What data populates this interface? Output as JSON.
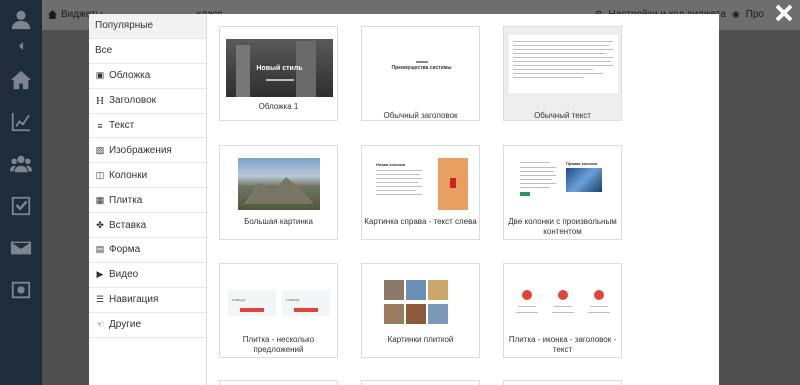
{
  "topbar": {
    "breadcrumb": "Виджеты",
    "breadcrumb_tail": "класс",
    "settings_label": "Настройки и код виджета",
    "preview_label": "Про"
  },
  "categories": [
    {
      "label": "Популярные",
      "icon": "none",
      "active": true
    },
    {
      "label": "Все",
      "icon": "none"
    },
    {
      "label": "Обложка",
      "icon": "camera-icon"
    },
    {
      "label": "Заголовок",
      "icon": "header-icon",
      "glyph": "H"
    },
    {
      "label": "Текст",
      "icon": "text-icon"
    },
    {
      "label": "Изображения",
      "icon": "image-icon"
    },
    {
      "label": "Колонки",
      "icon": "columns-icon"
    },
    {
      "label": "Плитка",
      "icon": "tiles-icon"
    },
    {
      "label": "Вставка",
      "icon": "puzzle-icon"
    },
    {
      "label": "Форма",
      "icon": "form-icon"
    },
    {
      "label": "Видео",
      "icon": "youtube-icon"
    },
    {
      "label": "Навигация",
      "icon": "list-icon"
    },
    {
      "label": "Другие",
      "icon": "hand-icon"
    }
  ],
  "templates": [
    {
      "label": "Обложка 1",
      "thumb_text": "Новый стиль"
    },
    {
      "label": "Обычный заголовок",
      "thumb_text": "Преимущества системы"
    },
    {
      "label": "Обычный текст",
      "selected": true
    },
    {
      "label": "Большая картинка"
    },
    {
      "label": "Картинка справа - текст слева",
      "thumb_text": "Новая колонка"
    },
    {
      "label": "Две колонки с произвольным контентом",
      "thumb_text": "Правая колонка"
    },
    {
      "label": "Плитка - несколько предложений",
      "thumb_text": "1 000 руб"
    },
    {
      "label": "Картинки плиткой"
    },
    {
      "label": "Плитка - иконка - заголовок - текст"
    }
  ],
  "colors": {
    "sidebar": "#1f2c39",
    "overlay": "#505050",
    "accent_red": "#e0443a",
    "modal_bg": "#ffffff"
  }
}
